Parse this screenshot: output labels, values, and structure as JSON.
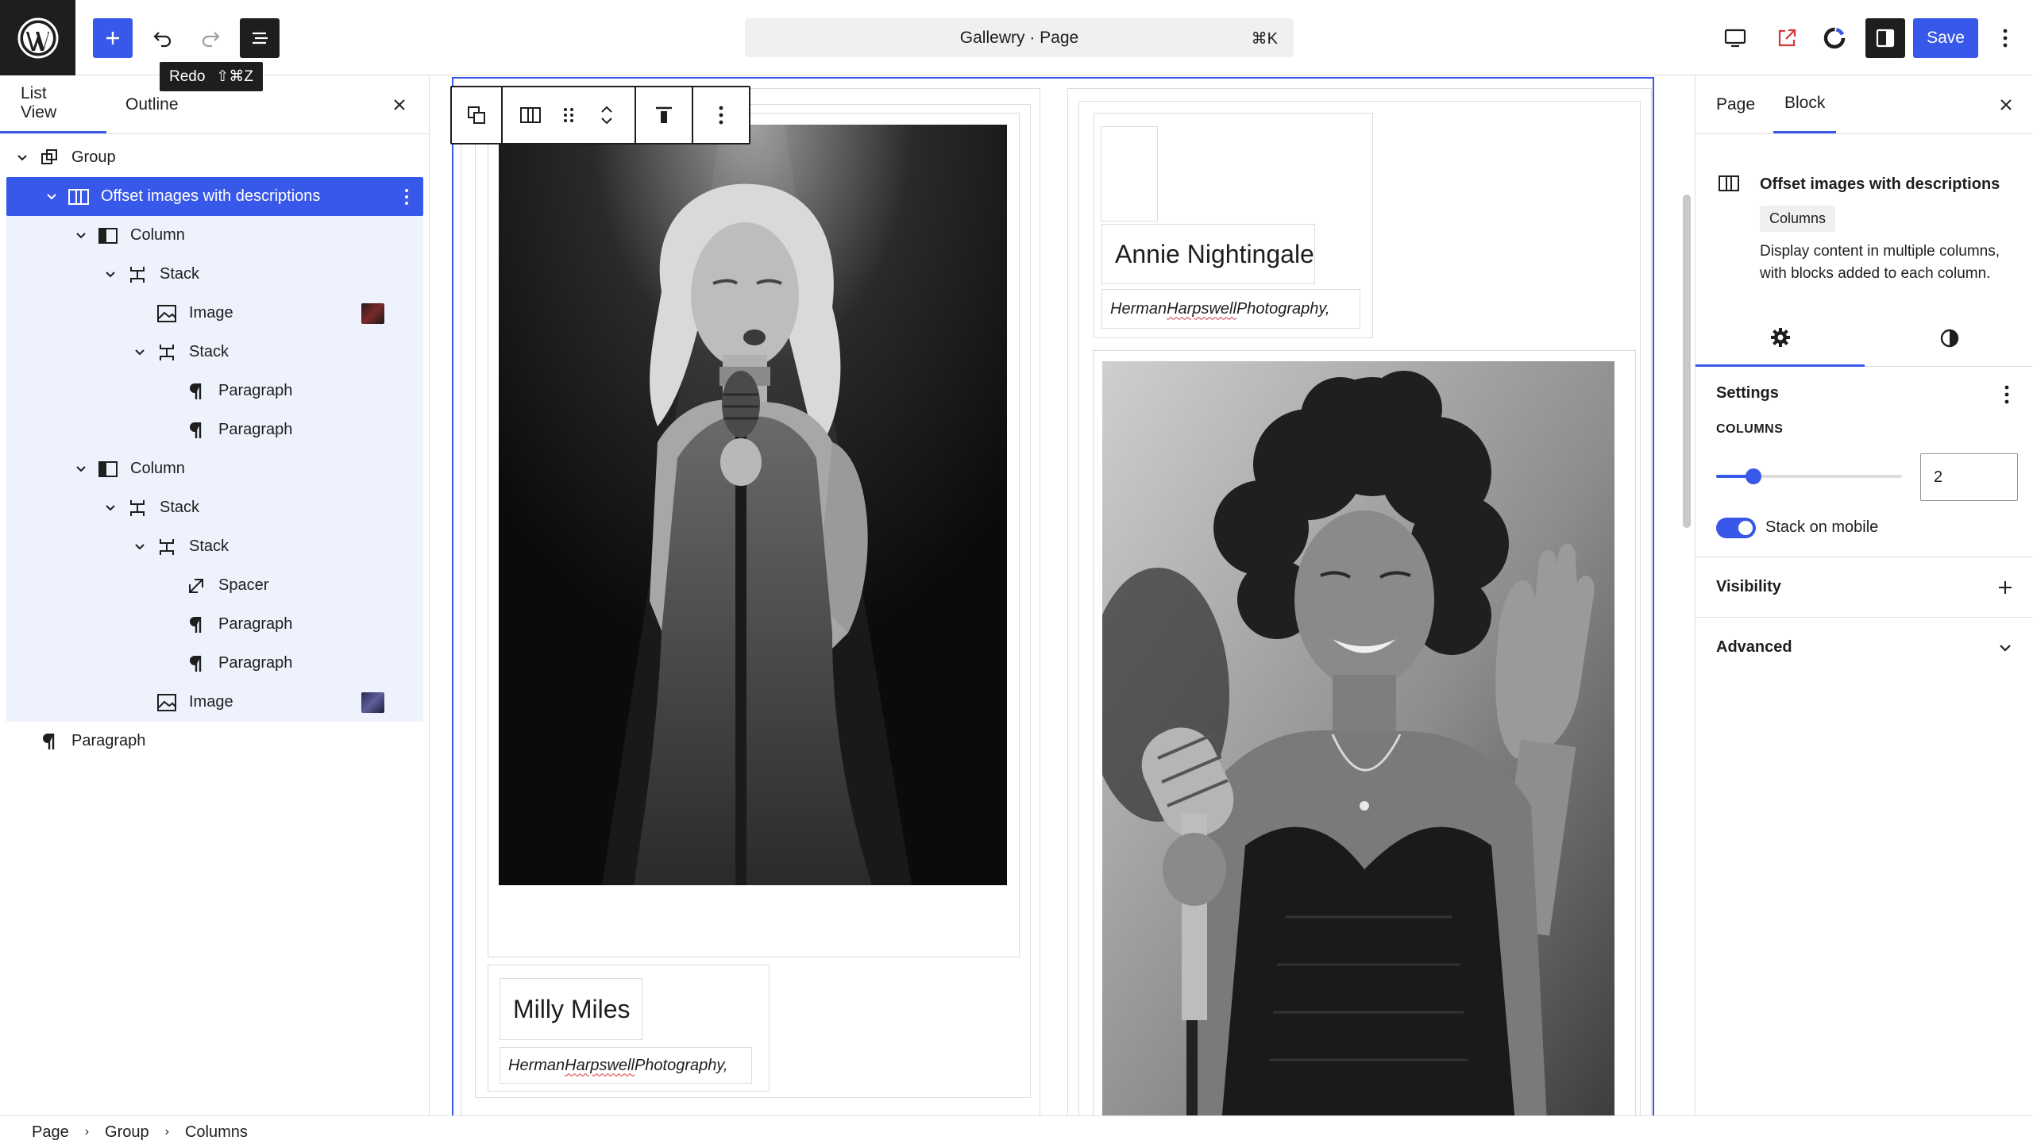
{
  "topbar": {
    "tooltip_label": "Redo",
    "tooltip_shortcut": "⇧⌘Z",
    "document_title": "Gallewry · Page",
    "command_shortcut": "⌘K",
    "save_label": "Save"
  },
  "left_panel": {
    "tabs": [
      "List View",
      "Outline"
    ],
    "tree": [
      {
        "label": "Group",
        "icon": "group-icon",
        "level": 0,
        "expanded": true
      },
      {
        "label": "Offset images with descriptions",
        "icon": "columns-icon",
        "level": 1,
        "expanded": true,
        "selected": true
      },
      {
        "label": "Column",
        "icon": "column-icon",
        "level": 2,
        "expanded": true
      },
      {
        "label": "Stack",
        "icon": "stack-icon",
        "level": 3,
        "expanded": true
      },
      {
        "label": "Image",
        "icon": "image-icon",
        "level": 4,
        "thumb": "red"
      },
      {
        "label": "Stack",
        "icon": "stack-icon",
        "level": 4,
        "expanded": true
      },
      {
        "label": "Paragraph",
        "icon": "paragraph-icon",
        "level": 5
      },
      {
        "label": "Paragraph",
        "icon": "paragraph-icon",
        "level": 5
      },
      {
        "label": "Column",
        "icon": "column-icon",
        "level": 2,
        "expanded": true
      },
      {
        "label": "Stack",
        "icon": "stack-icon",
        "level": 3,
        "expanded": true
      },
      {
        "label": "Stack",
        "icon": "stack-icon",
        "level": 4,
        "expanded": true
      },
      {
        "label": "Spacer",
        "icon": "spacer-icon",
        "level": 5
      },
      {
        "label": "Paragraph",
        "icon": "paragraph-icon",
        "level": 5
      },
      {
        "label": "Paragraph",
        "icon": "paragraph-icon",
        "level": 5
      },
      {
        "label": "Image",
        "icon": "image-icon",
        "level": 4,
        "thumb": "blue"
      },
      {
        "label": "Paragraph",
        "icon": "paragraph-icon",
        "level": 0
      }
    ]
  },
  "canvas": {
    "left_column": {
      "name": "Milly Miles",
      "caption_pre": "Herman ",
      "caption_misspelled": "Harpswell",
      "caption_post": " Photography,"
    },
    "right_column": {
      "name": "Annie Nightingale",
      "caption_pre": "Herman ",
      "caption_misspelled": "Harpswell",
      "caption_post": " Photography,"
    }
  },
  "right_panel": {
    "tabs": [
      "Page",
      "Block"
    ],
    "block_title": "Offset images with descriptions",
    "block_badge": "Columns",
    "block_description": "Display content in multiple columns, with blocks added to each column.",
    "settings_title": "Settings",
    "columns_label": "COLUMNS",
    "columns_value": "2",
    "columns_slider_fraction": 0.2,
    "stack_on_mobile_label": "Stack on mobile",
    "stack_on_mobile": true,
    "visibility_label": "Visibility",
    "advanced_label": "Advanced"
  },
  "breadcrumb": [
    "Page",
    "Group",
    "Columns"
  ],
  "colors": {
    "accent": "#3858e9",
    "dark": "#1e1e1e"
  }
}
